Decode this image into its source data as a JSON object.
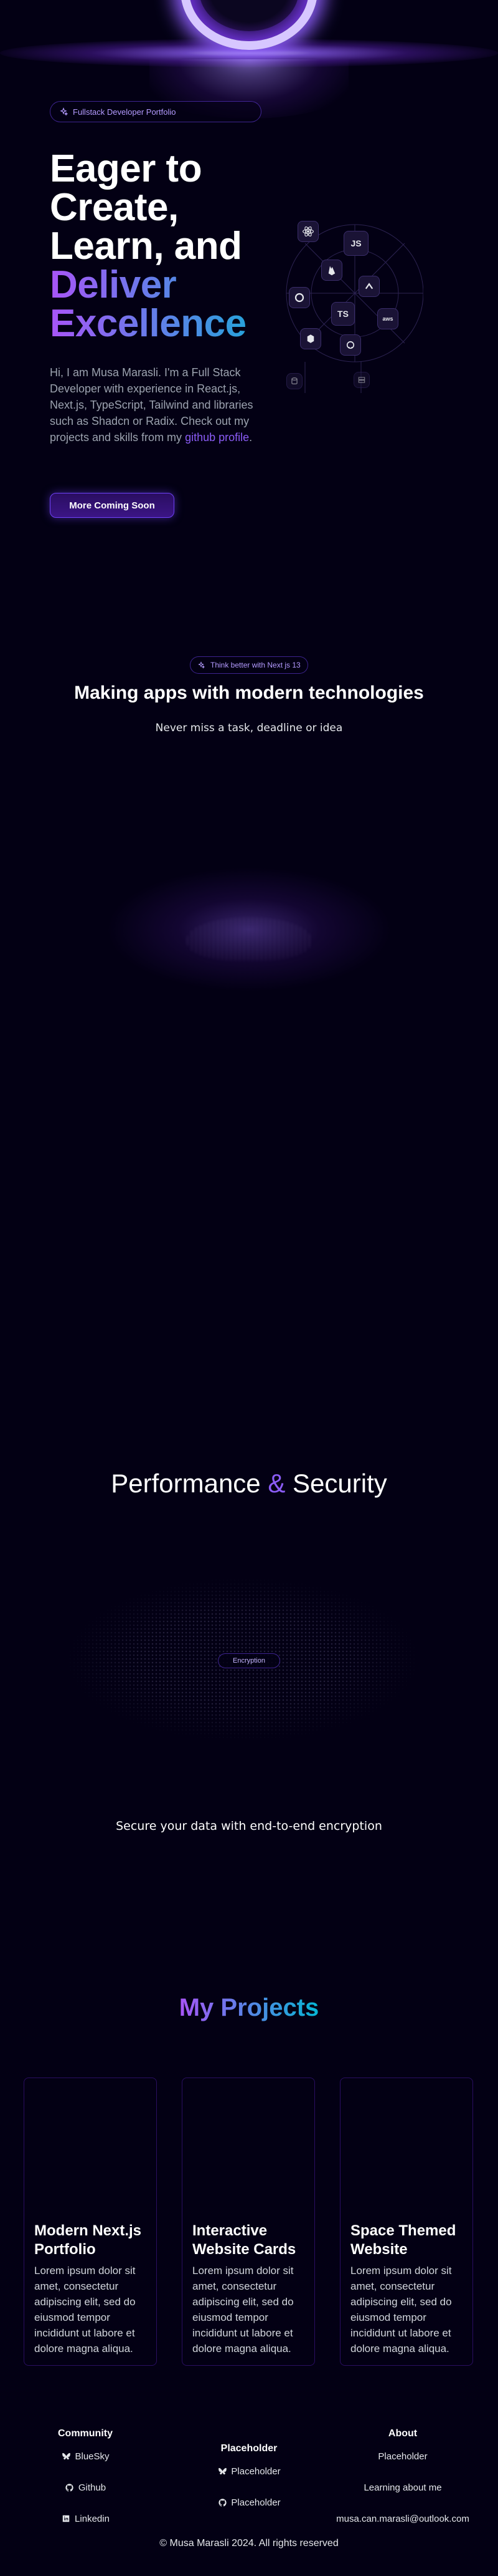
{
  "hero": {
    "badge": "Fullstack Developer Portfolio",
    "title_line1": "Eager to",
    "title_line2": "Create,",
    "title_line3": "Learn, and",
    "title_line4": "Deliver",
    "title_line5": "Excellence",
    "description": "Hi, I am Musa Marasli. I'm a Full Stack Developer with experience in React.js, Next.js, TypeScript, Tailwind and libraries such as Shadcn or Radix. Check out my projects and skills from my ",
    "description_link": "github profile",
    "description_end": ".",
    "button": "More Coming Soon",
    "tech_icons": [
      {
        "name": "react-icon",
        "glyph": "⚛"
      },
      {
        "name": "js-icon",
        "glyph": "JS"
      },
      {
        "name": "nextjs-icon",
        "glyph": "▲"
      },
      {
        "name": "firebase-icon",
        "glyph": "▲"
      },
      {
        "name": "ts-icon",
        "glyph": "TS"
      },
      {
        "name": "aws-icon",
        "glyph": "aws"
      },
      {
        "name": "github-icon",
        "glyph": "◉"
      },
      {
        "name": "graphql-icon",
        "glyph": "◎"
      }
    ]
  },
  "section2": {
    "badge": "Think better with Next js 13",
    "title": "Making apps with modern technologies",
    "subtitle": "Never miss a task, deadline or idea"
  },
  "section3": {
    "title_part1": "Performance",
    "title_amp": "&",
    "title_part2": "Security",
    "encryption_label": "Encryption",
    "subtitle": "Secure your data with end-to-end encryption"
  },
  "projects": {
    "title": "My Projects",
    "cards": [
      {
        "title": "Modern Next.js Portfolio",
        "text": "Lorem ipsum dolor sit amet, consectetur adipiscing elit, sed do eiusmod tempor incididunt ut labore et dolore magna aliqua."
      },
      {
        "title": "Interactive Website Cards",
        "text": "Lorem ipsum dolor sit amet, consectetur adipiscing elit, sed do eiusmod tempor incididunt ut labore et dolore magna aliqua."
      },
      {
        "title": "Space Themed Website",
        "text": "Lorem ipsum dolor sit amet, consectetur adipiscing elit, sed do eiusmod tempor incididunt ut labore et dolore magna aliqua."
      }
    ]
  },
  "footer": {
    "community": {
      "heading": "Community",
      "items": [
        "BlueSky",
        "Github",
        "Linkedin"
      ]
    },
    "placeholder": {
      "heading": "Placeholder",
      "items": [
        "Placeholder",
        "Placeholder"
      ]
    },
    "about": {
      "heading": "About",
      "items": [
        "Placeholder",
        "Learning about me",
        "musa.can.marasli@outlook.com"
      ]
    },
    "copyright": "© Musa Marasli 2024. All rights reserved"
  },
  "colors": {
    "background": "#030014",
    "accent": "#7042f8",
    "gradient_start": "#a855f7",
    "gradient_end": "#06b6d4"
  }
}
